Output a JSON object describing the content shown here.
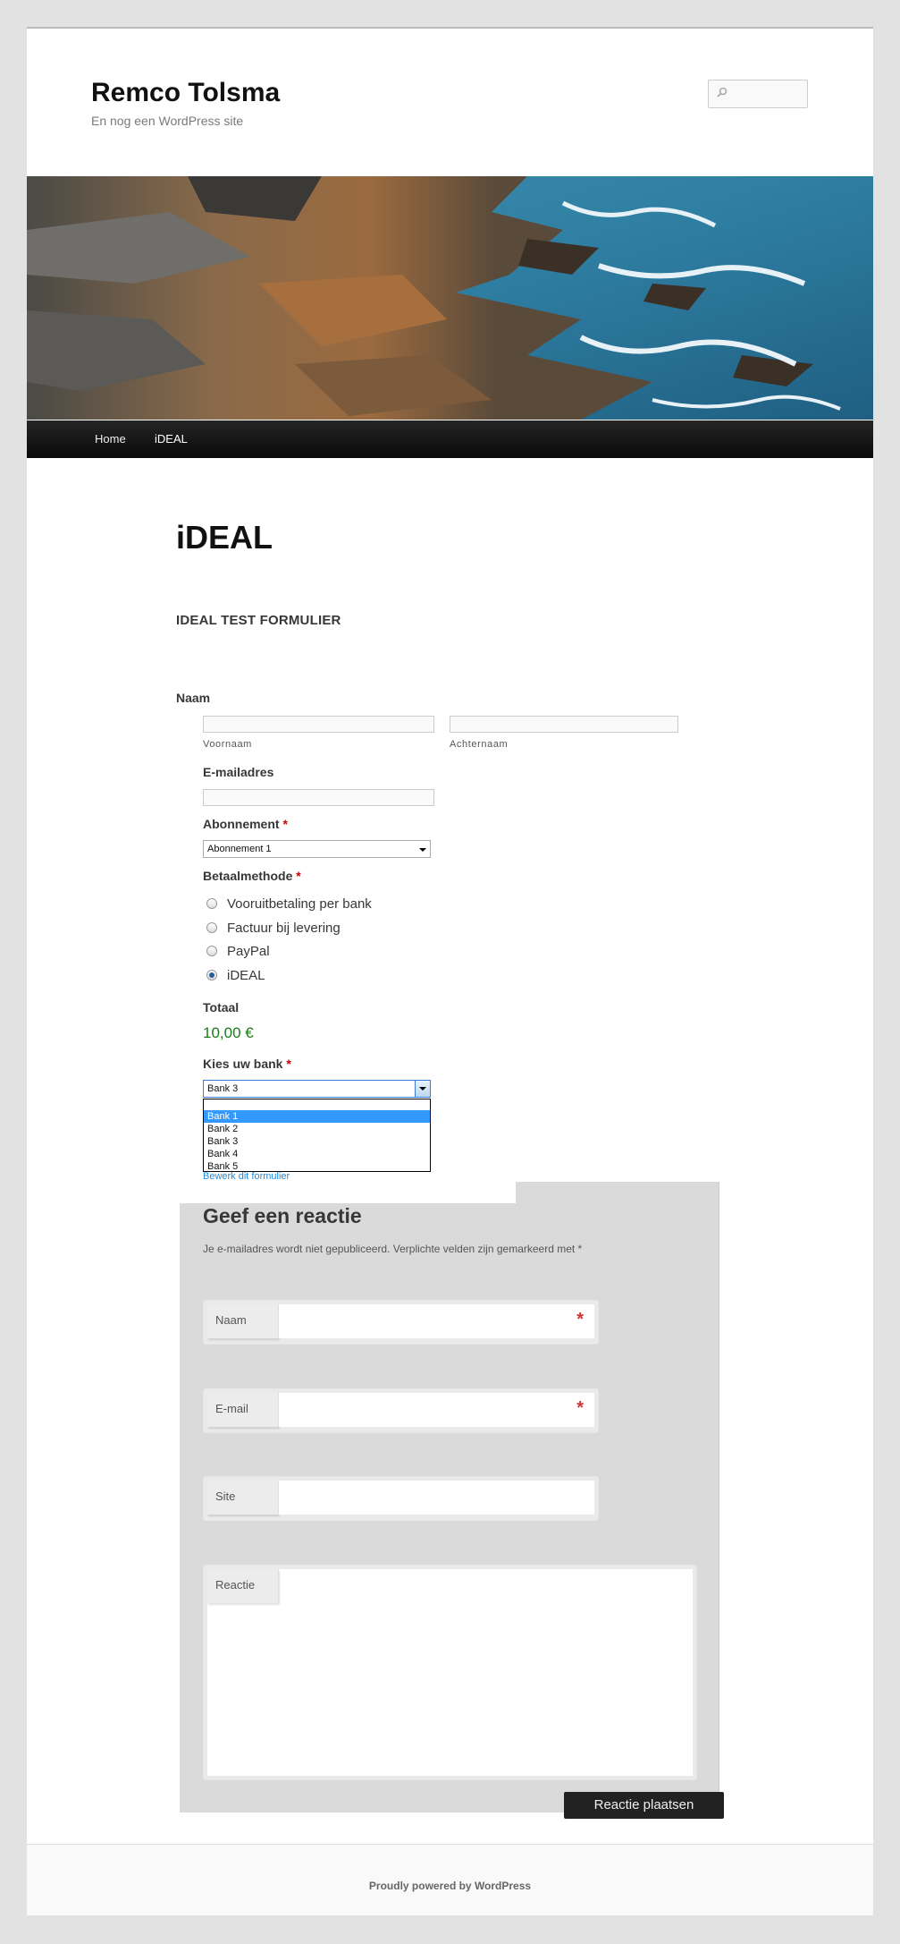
{
  "site": {
    "title": "Remco Tolsma",
    "description": "En nog een WordPress site"
  },
  "search": {
    "placeholder": ""
  },
  "nav": {
    "items": [
      "Home",
      "iDEAL"
    ]
  },
  "entry": {
    "title": "iDEAL"
  },
  "form": {
    "title": "IDEAL TEST FORMULIER",
    "naam_label": "Naam",
    "voornaam_sublabel": "Voornaam",
    "achternaam_sublabel": "Achternaam",
    "email_label": "E-mailadres",
    "abonnement_label": "Abonnement",
    "required_mark": "*",
    "abonnement_value": "Abonnement 1",
    "betaal_label": "Betaalmethode",
    "betaal_options": [
      "Vooruitbetaling per bank",
      "Factuur bij levering",
      "PayPal",
      "iDEAL"
    ],
    "betaal_selected": "iDEAL",
    "totaal_label": "Totaal",
    "totaal_value": "10,00 €",
    "bank_label": "Kies uw bank",
    "bank_value": "Bank 3",
    "bank_options": [
      "Bank 1",
      "Bank 2",
      "Bank 3",
      "Bank 4",
      "Bank 5"
    ],
    "bank_highlighted": "Bank 1",
    "edit_link": "Bewerk dit formulier"
  },
  "comments": {
    "title": "Geef een reactie",
    "notes": "Je e-mailadres wordt niet gepubliceerd. Verplichte velden zijn gemarkeerd met *",
    "fields": {
      "name": "Naam",
      "email": "E-mail",
      "site": "Site",
      "comment": "Reactie"
    },
    "required_star": "*",
    "submit": "Reactie plaatsen"
  },
  "footer": {
    "credit": "Proudly powered by WordPress"
  },
  "colors": {
    "accent": "#1b8be0",
    "total": "#1a7a1a",
    "required": "#cc0000",
    "selection": "#3399ff"
  }
}
